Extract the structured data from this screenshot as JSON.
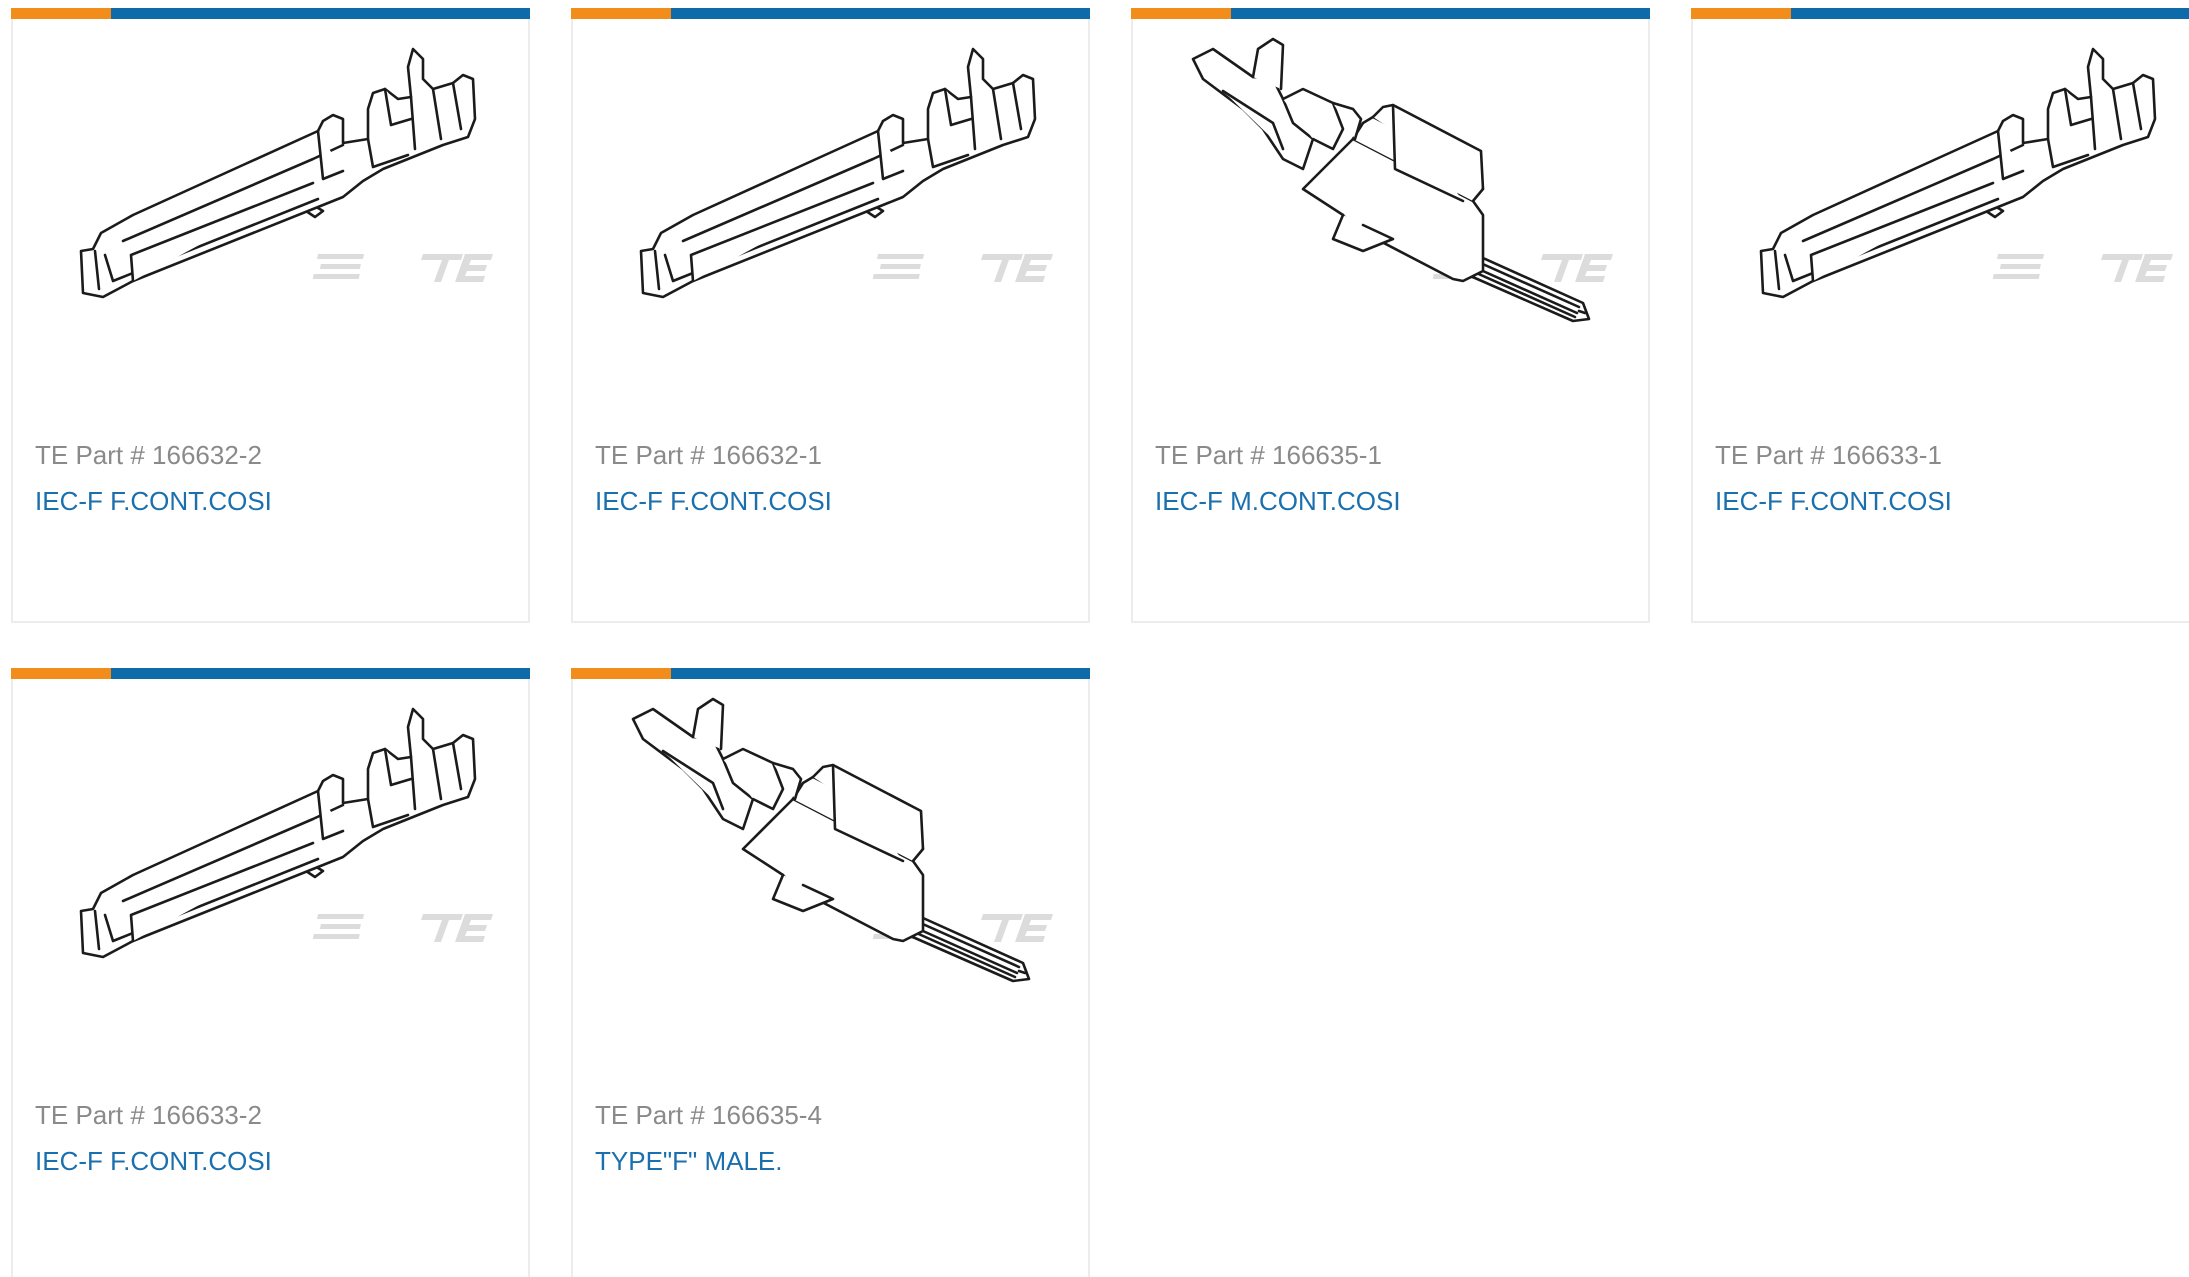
{
  "colors": {
    "accent_orange": "#f28c1a",
    "accent_blue": "#0e6aa8",
    "link_blue": "#1a6fae",
    "label_gray": "#8a8a8a",
    "card_border": "#ececec"
  },
  "brand_watermark": "TE",
  "cards": [
    {
      "part_label": "TE Part # 166632-2",
      "name": "IEC-F F.CONT.COSI",
      "image_icon": "female-contact-icon"
    },
    {
      "part_label": "TE Part # 166632-1",
      "name": "IEC-F F.CONT.COSI",
      "image_icon": "female-contact-icon"
    },
    {
      "part_label": "TE Part # 166635-1",
      "name": "IEC-F M.CONT.COSI",
      "image_icon": "male-contact-icon"
    },
    {
      "part_label": "TE Part # 166633-1",
      "name": "IEC-F F.CONT.COSI",
      "image_icon": "female-contact-icon"
    },
    {
      "part_label": "TE Part # 166633-2",
      "name": "IEC-F F.CONT.COSI",
      "image_icon": "female-contact-icon"
    },
    {
      "part_label": "TE Part # 166635-4",
      "name": "TYPE\"F\" MALE.",
      "image_icon": "male-contact-icon"
    }
  ]
}
